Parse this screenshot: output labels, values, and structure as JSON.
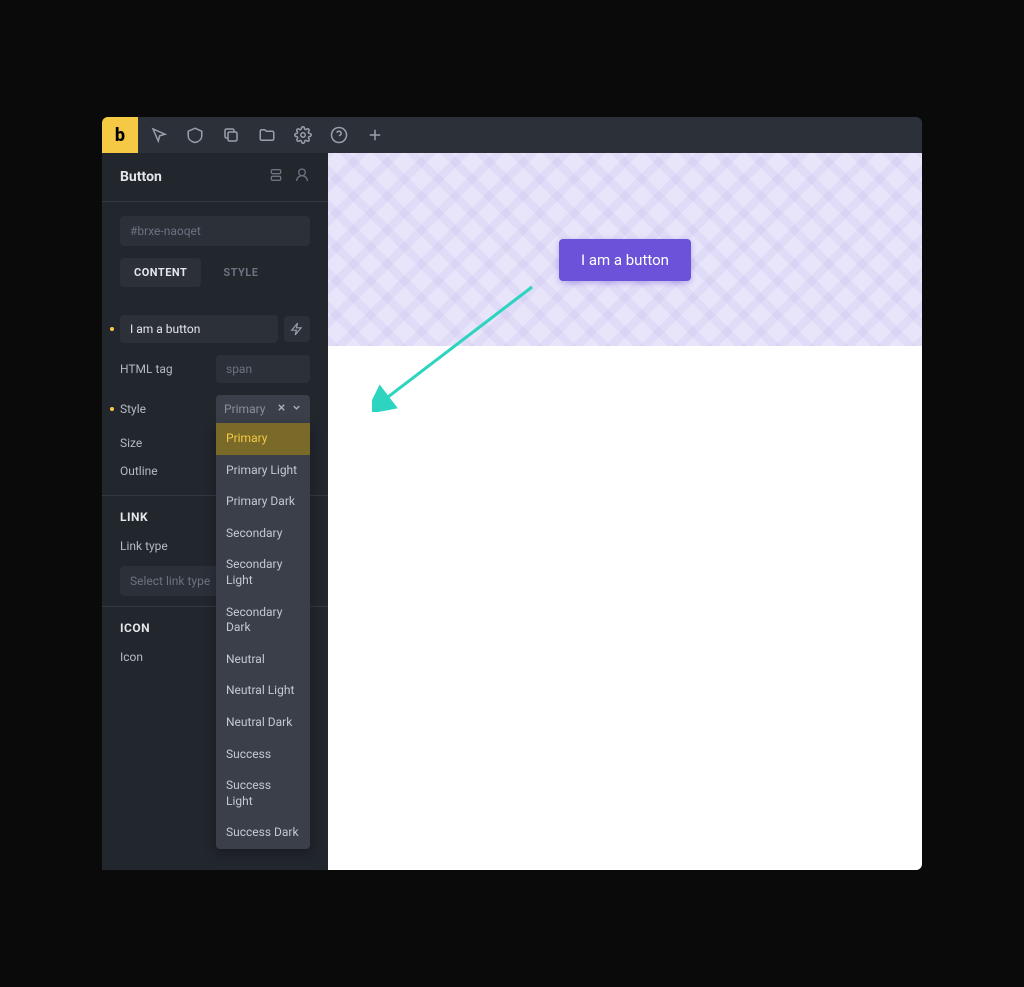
{
  "logo": "b",
  "panel": {
    "title": "Button"
  },
  "classInput": {
    "placeholder": "#brxe-naoqet"
  },
  "tabs": {
    "content": "CONTENT",
    "style": "STYLE"
  },
  "content": {
    "text_value": "I am a button",
    "html_tag_label": "HTML tag",
    "html_tag_value": "span",
    "style_label": "Style",
    "style_value": "Primary",
    "size_label": "Size",
    "outline_label": "Outline"
  },
  "style_options": [
    "Primary",
    "Primary Light",
    "Primary Dark",
    "Secondary",
    "Secondary Light",
    "Secondary Dark",
    "Neutral",
    "Neutral Light",
    "Neutral Dark",
    "Success",
    "Success Light",
    "Success Dark"
  ],
  "link": {
    "header": "LINK",
    "type_label": "Link type",
    "placeholder": "Select link type"
  },
  "icon": {
    "header": "ICON",
    "label": "Icon"
  },
  "preview": {
    "button_text": "I am a button"
  }
}
